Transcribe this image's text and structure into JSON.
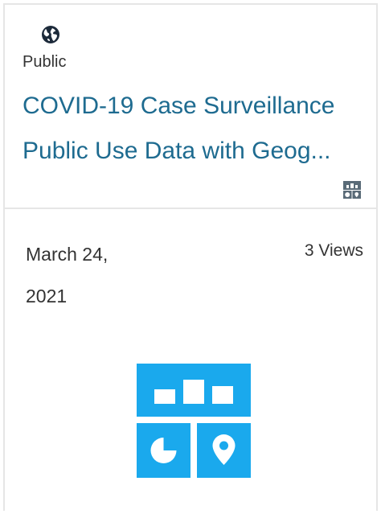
{
  "card": {
    "visibility": "Public",
    "title_line1": "COVID-19 Case Surveillance",
    "title_line2": "Public Use Data with Geog...",
    "date_line1": "March 24,",
    "date_line2": "2021",
    "views": "3 Views",
    "icons": {
      "visibility": "globe-icon",
      "type_small": "dashboard-icon",
      "type_large": "dashboard-thumbnail-icon"
    },
    "colors": {
      "title": "#1e6b90",
      "thumbnail_accent": "#1aa9ed",
      "small_icon": "#5a6b78"
    }
  }
}
